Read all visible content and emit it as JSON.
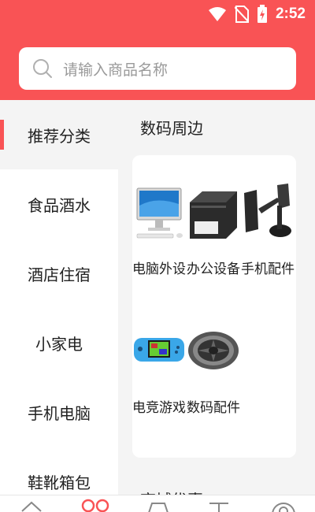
{
  "status": {
    "time": "2:52"
  },
  "search": {
    "placeholder": "请输入商品名称"
  },
  "sidebar": {
    "items": [
      {
        "label": "推荐分类",
        "active": true
      },
      {
        "label": "食品酒水"
      },
      {
        "label": "酒店住宿"
      },
      {
        "label": "小家电"
      },
      {
        "label": "手机电脑"
      },
      {
        "label": "鞋靴箱包"
      }
    ]
  },
  "content": {
    "section1": {
      "title": "数码周边",
      "products": [
        {
          "label": "电脑外设",
          "icon": "desktop-computer-icon"
        },
        {
          "label": "办公设备",
          "icon": "printer-icon"
        },
        {
          "label": "手机配件",
          "icon": "phone-mount-icon"
        },
        {
          "label": "电竞游戏",
          "icon": "handheld-game-icon"
        },
        {
          "label": "数码配件",
          "icon": "cpu-fan-icon"
        }
      ]
    },
    "section2": {
      "title": "商城优惠"
    }
  },
  "colors": {
    "accent": "#f95355"
  }
}
